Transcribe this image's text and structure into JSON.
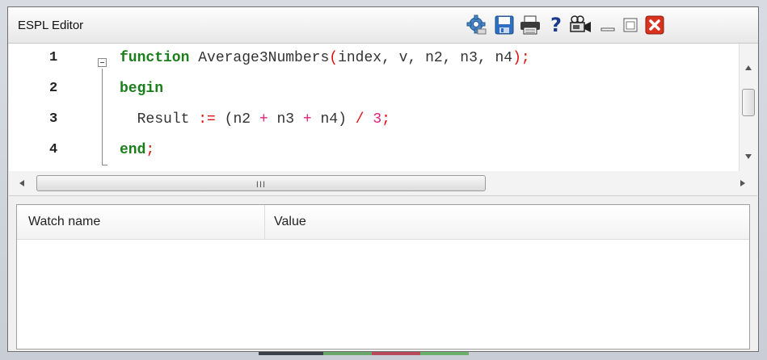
{
  "window": {
    "title": "ESPL Editor"
  },
  "toolbar": {
    "icons": [
      "settings-gear-icon",
      "save-icon",
      "print-icon",
      "help-icon",
      "camera-icon",
      "minimize-icon",
      "maximize-icon",
      "close-icon"
    ],
    "help_glyph": "?"
  },
  "editor": {
    "line_numbers": [
      "1",
      "2",
      "3",
      "4"
    ],
    "lines": {
      "l1_kw": "function",
      "l1_name": " Average3Numbers",
      "l1_open": "(",
      "l1_args": "index, v, n2, n3, n4",
      "l1_close": ");",
      "l2_kw": "begin",
      "l3_indent": "  ",
      "l3_result": "Result ",
      "l3_assign": ":=",
      "l3_open": " (",
      "l3_n2": "n2 ",
      "l3_plus1": "+",
      "l3_n3": " n3 ",
      "l3_plus2": "+",
      "l3_n4": " n4",
      "l3_close": ") ",
      "l3_div": "/",
      "l3_space": " ",
      "l3_num": "3",
      "l3_semi": ";",
      "l4_kw": "end",
      "l4_semi": ";"
    }
  },
  "hscroll": {
    "grip": "III"
  },
  "watch": {
    "columns": [
      "Watch name",
      "Value"
    ],
    "rows": []
  },
  "colors": {
    "keyword": "#1a7f1a",
    "operator": "#e0237b",
    "punctuation": "#e01010",
    "close_button": "#d9321f"
  }
}
